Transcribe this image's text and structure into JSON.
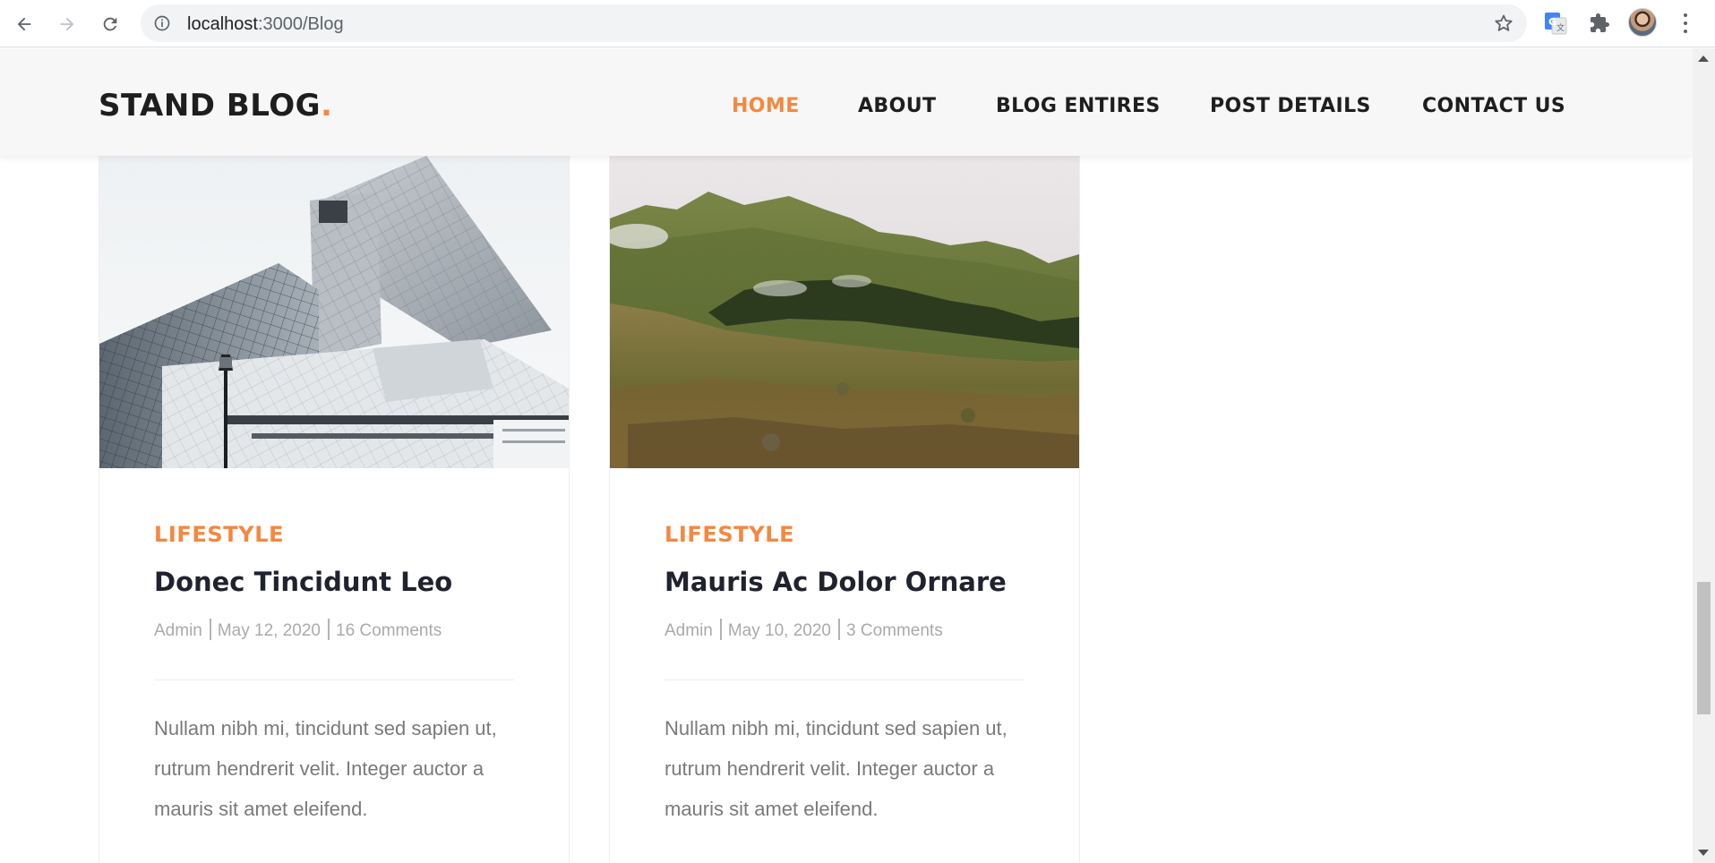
{
  "browser": {
    "url_host": "localhost",
    "url_rest": ":3000/Blog"
  },
  "site": {
    "logo_text": "STAND BLOG",
    "logo_dot": ".",
    "accent_color": "#f48840",
    "nav": [
      {
        "label": "HOME",
        "active": true
      },
      {
        "label": "ABOUT",
        "active": false
      },
      {
        "label": "BLOG ENTIRES",
        "active": false
      },
      {
        "label": "POST DETAILS",
        "active": false
      },
      {
        "label": "CONTACT US",
        "active": false
      }
    ]
  },
  "posts": [
    {
      "image": "modern-glass-building-photo",
      "category": "LIFESTYLE",
      "title": "Donec Tincidunt Leo",
      "author": "Admin",
      "date": "May 12, 2020",
      "comments": "16 Comments",
      "excerpt": "Nullam nibh mi, tincidunt sed sapien ut, rutrum hendrerit velit. Integer auctor a mauris sit amet eleifend."
    },
    {
      "image": "green-mountain-landscape-photo",
      "category": "LIFESTYLE",
      "title": "Mauris Ac Dolor Ornare",
      "author": "Admin",
      "date": "May 10, 2020",
      "comments": "3 Comments",
      "excerpt": "Nullam nibh mi, tincidunt sed sapien ut, rutrum hendrerit velit. Integer auctor a mauris sit amet eleifend."
    }
  ]
}
